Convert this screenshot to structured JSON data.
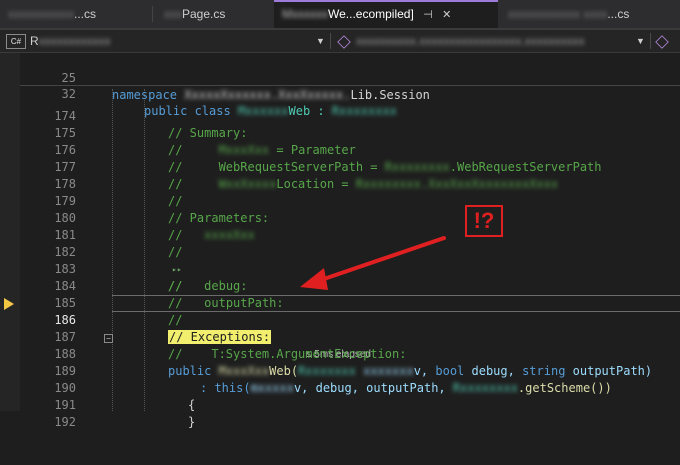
{
  "tabs": [
    {
      "title": "...cs",
      "blurred": true
    },
    {
      "title": "Page.cs",
      "blurred": true
    },
    {
      "title": "We...ecompiled]",
      "active": true
    },
    {
      "title": "...cs",
      "blurred": true
    }
  ],
  "nav": {
    "project_prefix": "R",
    "lang_badge": "C#",
    "member_suffix": "M"
  },
  "lines": [
    {
      "n": "25",
      "text": "namespace"
    },
    {
      "n": "32",
      "text": "public class"
    },
    {
      "n": "174",
      "text": "// Summary:"
    },
    {
      "n": "175",
      "text": "//"
    },
    {
      "n": "176",
      "text": "//"
    },
    {
      "n": "177",
      "text": "//"
    },
    {
      "n": "178",
      "text": "//"
    },
    {
      "n": "179",
      "text": "// Parameters:"
    },
    {
      "n": "180",
      "text": "//"
    },
    {
      "n": "181",
      "text": "//"
    },
    {
      "n": "182",
      "text": "//"
    },
    {
      "n": "183",
      "text": "//"
    },
    {
      "n": "184",
      "text": "//"
    },
    {
      "n": "185",
      "text": "//"
    },
    {
      "n": "186",
      "text": "// Exceptions:"
    },
    {
      "n": "187",
      "text": "//"
    },
    {
      "n": "188",
      "text": "public"
    },
    {
      "n": "189",
      "text": ": this("
    },
    {
      "n": "190",
      "text": "{"
    },
    {
      "n": "191",
      "text": "}"
    },
    {
      "n": "192",
      "text": ""
    }
  ],
  "code": {
    "ns_tail": "Lib.Session",
    "class_tail": "Web : ",
    "l175_assign": "= Parameter",
    "l176_tail": ".WebRequestServerPath",
    "l176_mid": "WebRequestServerPath = ",
    "l177_mid": "Location = ",
    "l182_param": "debug:",
    "l185_param": "outputPath:",
    "l186_elapsed": "≤ 5ms elapsed",
    "l187_text": "    T:System.ArgumentException:",
    "l188_sig_a": "Web(",
    "l188_sig_b": "v, ",
    "l188_bool": "bool",
    "l188_debug": " debug, ",
    "l188_string": "string",
    "l188_out": " outputPath)",
    "l189_a": "v, debug, outputPath, ",
    "l189_b": ".getScheme())"
  },
  "annotation": {
    "label": "!?",
    "color": "#e02020"
  }
}
